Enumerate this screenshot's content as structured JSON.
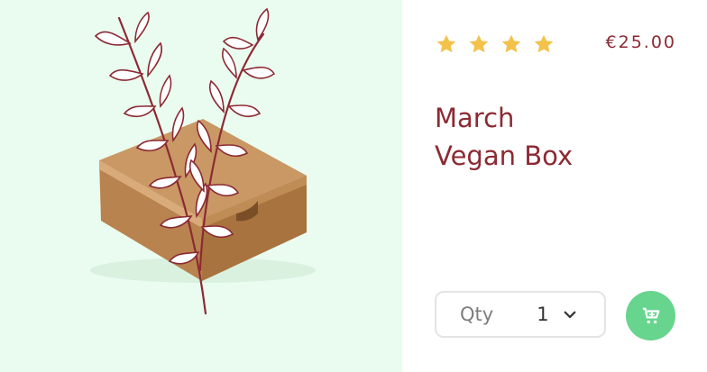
{
  "product": {
    "title_line1": "March",
    "title_line2": "Vegan Box",
    "price": "€25.00",
    "rating_stars": 4,
    "image_name": "kraft-box-with-olive-branch"
  },
  "quantity": {
    "label": "Qty",
    "value": "1",
    "icon": "chevron-down-icon"
  },
  "cart": {
    "icon": "add-to-cart-icon"
  },
  "colors": {
    "accent": "#8c2a33",
    "star": "#f3c24a",
    "button": "#67d58d",
    "image_background": "#eafcf0"
  }
}
